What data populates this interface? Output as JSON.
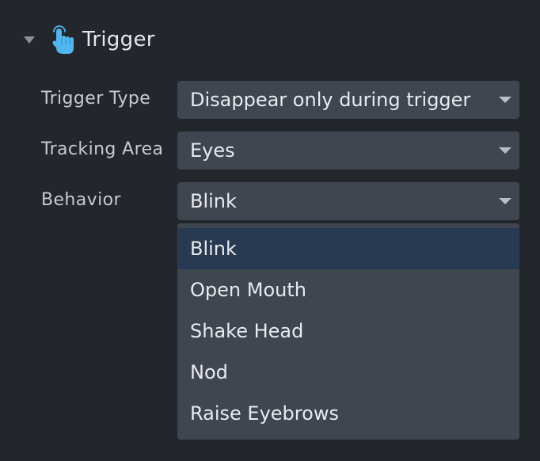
{
  "section": {
    "title": "Trigger",
    "icon": "pointing-hand-icon"
  },
  "fields": {
    "trigger_type": {
      "label": "Trigger Type",
      "value": "Disappear only during trigger"
    },
    "tracking_area": {
      "label": "Tracking Area",
      "value": "Eyes"
    },
    "behavior": {
      "label": "Behavior",
      "value": "Blink"
    }
  },
  "behavior_dropdown": {
    "options": [
      "Blink",
      "Open Mouth",
      "Shake Head",
      "Nod",
      "Raise Eyebrows"
    ],
    "selected": "Blink"
  },
  "colors": {
    "background": "#23262b",
    "field_bg": "#3f4650",
    "selected_bg": "#283a51",
    "icon_blue": "#4fb7f0"
  }
}
